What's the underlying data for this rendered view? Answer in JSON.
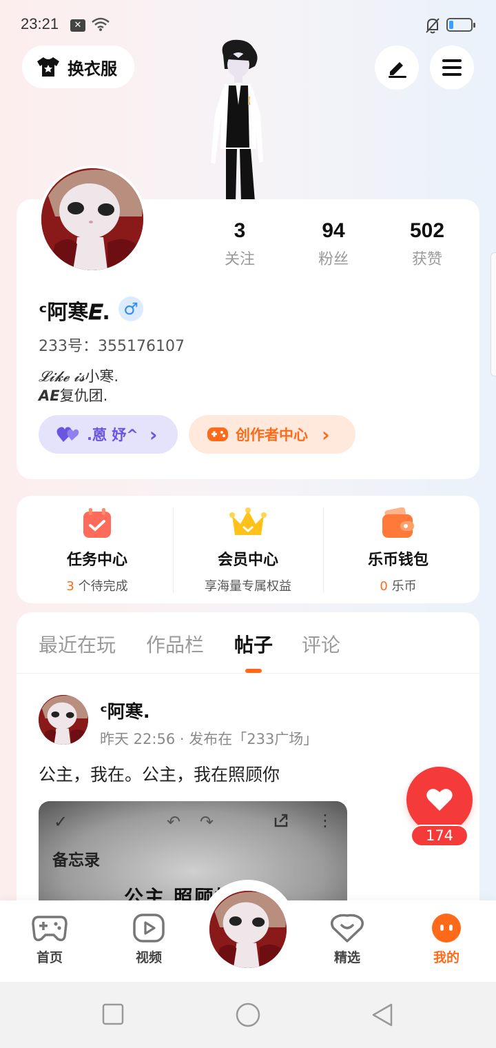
{
  "status_bar": {
    "time": "23:21",
    "x_badge": "✕"
  },
  "top": {
    "outfit_label": "换衣服"
  },
  "profile": {
    "username": "ᶜ阿寒𝑬.",
    "gender_symbol": "♂",
    "uid": "233号：355176107",
    "bio_line1_script": "𝓛𝓲𝓴𝓮 𝓲𝓼",
    "bio_line1_rest": "小寒.",
    "bio_line2_bold": "AE",
    "bio_line2_rest": "复仇团.",
    "stats": [
      {
        "value": "3",
        "label": "关注"
      },
      {
        "value": "94",
        "label": "粉丝"
      },
      {
        "value": "502",
        "label": "获赞"
      }
    ],
    "pill_purple": ".蒽  妤^",
    "pill_orange": "创作者中心",
    "pill_arrow": "›"
  },
  "services": [
    {
      "title": "任务中心",
      "count": "3",
      "sub": " 个待完成"
    },
    {
      "title": "会员中心",
      "count": "",
      "sub": "享海量专属权益"
    },
    {
      "title": "乐币钱包",
      "count": "0",
      "sub": " 乐币"
    }
  ],
  "tabs": [
    "最近在玩",
    "作品栏",
    "帖子",
    "评论"
  ],
  "post": {
    "author": "ᶜ阿寒.",
    "meta": "昨天 22:56 · 发布在「233广场」",
    "text": "公主，我在。公主，我在照顾你",
    "image_memo": "备忘录",
    "image_big": "公主 照顾好",
    "image_check": "✓",
    "image_undo": "↶",
    "image_redo": "↷",
    "image_more": "⋮"
  },
  "like": {
    "count": "174"
  },
  "bottom_nav": [
    {
      "label": "首页"
    },
    {
      "label": "视频"
    },
    {
      "label": "精选"
    },
    {
      "label": "我的"
    }
  ],
  "colors": {
    "accent": "#ff6a1a",
    "like_red": "#f53a3a",
    "purple": "#6a55e0"
  }
}
